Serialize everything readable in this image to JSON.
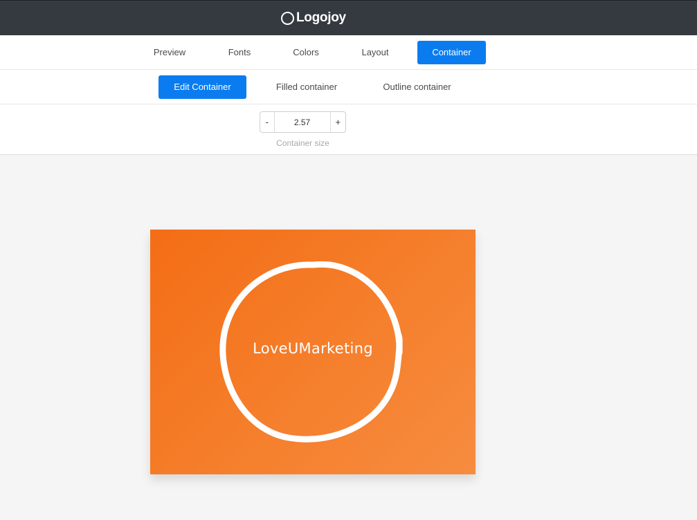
{
  "header": {
    "brand": "Logojoy"
  },
  "nav": {
    "tabs": [
      {
        "label": "Preview"
      },
      {
        "label": "Fonts"
      },
      {
        "label": "Colors"
      },
      {
        "label": "Layout"
      },
      {
        "label": "Container",
        "active": true
      }
    ]
  },
  "subnav": {
    "tabs": [
      {
        "label": "Edit Container",
        "active": true
      },
      {
        "label": "Filled container"
      },
      {
        "label": "Outline container"
      }
    ]
  },
  "container_size": {
    "decrement_label": "-",
    "value": "2.57",
    "increment_label": "+",
    "label": "Container size"
  },
  "logo": {
    "text": "LoveUMarketing",
    "background_color": "#f57520",
    "ring_color": "#ffffff"
  },
  "colors": {
    "header_bg": "#353a40",
    "accent": "#0a7cf0"
  },
  "icons": {
    "brand": "logojoy-circle-icon"
  }
}
